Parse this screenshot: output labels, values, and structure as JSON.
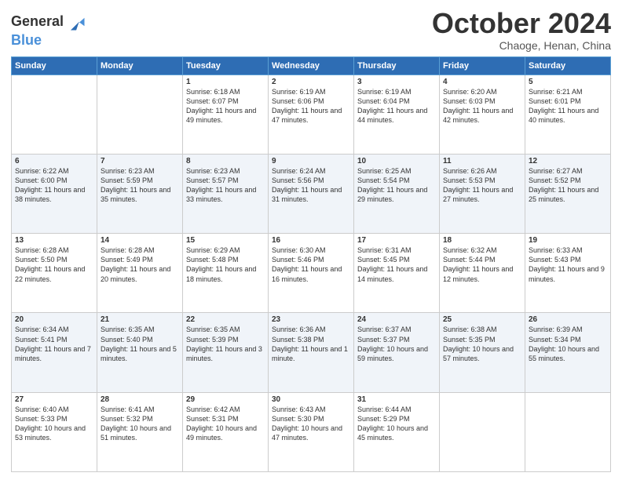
{
  "logo": {
    "line1": "General",
    "line2": "Blue"
  },
  "title": "October 2024",
  "location": "Chaoge, Henan, China",
  "days_of_week": [
    "Sunday",
    "Monday",
    "Tuesday",
    "Wednesday",
    "Thursday",
    "Friday",
    "Saturday"
  ],
  "weeks": [
    [
      {
        "day": "",
        "info": ""
      },
      {
        "day": "",
        "info": ""
      },
      {
        "day": "1",
        "info": "Sunrise: 6:18 AM\nSunset: 6:07 PM\nDaylight: 11 hours and 49 minutes."
      },
      {
        "day": "2",
        "info": "Sunrise: 6:19 AM\nSunset: 6:06 PM\nDaylight: 11 hours and 47 minutes."
      },
      {
        "day": "3",
        "info": "Sunrise: 6:19 AM\nSunset: 6:04 PM\nDaylight: 11 hours and 44 minutes."
      },
      {
        "day": "4",
        "info": "Sunrise: 6:20 AM\nSunset: 6:03 PM\nDaylight: 11 hours and 42 minutes."
      },
      {
        "day": "5",
        "info": "Sunrise: 6:21 AM\nSunset: 6:01 PM\nDaylight: 11 hours and 40 minutes."
      }
    ],
    [
      {
        "day": "6",
        "info": "Sunrise: 6:22 AM\nSunset: 6:00 PM\nDaylight: 11 hours and 38 minutes."
      },
      {
        "day": "7",
        "info": "Sunrise: 6:23 AM\nSunset: 5:59 PM\nDaylight: 11 hours and 35 minutes."
      },
      {
        "day": "8",
        "info": "Sunrise: 6:23 AM\nSunset: 5:57 PM\nDaylight: 11 hours and 33 minutes."
      },
      {
        "day": "9",
        "info": "Sunrise: 6:24 AM\nSunset: 5:56 PM\nDaylight: 11 hours and 31 minutes."
      },
      {
        "day": "10",
        "info": "Sunrise: 6:25 AM\nSunset: 5:54 PM\nDaylight: 11 hours and 29 minutes."
      },
      {
        "day": "11",
        "info": "Sunrise: 6:26 AM\nSunset: 5:53 PM\nDaylight: 11 hours and 27 minutes."
      },
      {
        "day": "12",
        "info": "Sunrise: 6:27 AM\nSunset: 5:52 PM\nDaylight: 11 hours and 25 minutes."
      }
    ],
    [
      {
        "day": "13",
        "info": "Sunrise: 6:28 AM\nSunset: 5:50 PM\nDaylight: 11 hours and 22 minutes."
      },
      {
        "day": "14",
        "info": "Sunrise: 6:28 AM\nSunset: 5:49 PM\nDaylight: 11 hours and 20 minutes."
      },
      {
        "day": "15",
        "info": "Sunrise: 6:29 AM\nSunset: 5:48 PM\nDaylight: 11 hours and 18 minutes."
      },
      {
        "day": "16",
        "info": "Sunrise: 6:30 AM\nSunset: 5:46 PM\nDaylight: 11 hours and 16 minutes."
      },
      {
        "day": "17",
        "info": "Sunrise: 6:31 AM\nSunset: 5:45 PM\nDaylight: 11 hours and 14 minutes."
      },
      {
        "day": "18",
        "info": "Sunrise: 6:32 AM\nSunset: 5:44 PM\nDaylight: 11 hours and 12 minutes."
      },
      {
        "day": "19",
        "info": "Sunrise: 6:33 AM\nSunset: 5:43 PM\nDaylight: 11 hours and 9 minutes."
      }
    ],
    [
      {
        "day": "20",
        "info": "Sunrise: 6:34 AM\nSunset: 5:41 PM\nDaylight: 11 hours and 7 minutes."
      },
      {
        "day": "21",
        "info": "Sunrise: 6:35 AM\nSunset: 5:40 PM\nDaylight: 11 hours and 5 minutes."
      },
      {
        "day": "22",
        "info": "Sunrise: 6:35 AM\nSunset: 5:39 PM\nDaylight: 11 hours and 3 minutes."
      },
      {
        "day": "23",
        "info": "Sunrise: 6:36 AM\nSunset: 5:38 PM\nDaylight: 11 hours and 1 minute."
      },
      {
        "day": "24",
        "info": "Sunrise: 6:37 AM\nSunset: 5:37 PM\nDaylight: 10 hours and 59 minutes."
      },
      {
        "day": "25",
        "info": "Sunrise: 6:38 AM\nSunset: 5:35 PM\nDaylight: 10 hours and 57 minutes."
      },
      {
        "day": "26",
        "info": "Sunrise: 6:39 AM\nSunset: 5:34 PM\nDaylight: 10 hours and 55 minutes."
      }
    ],
    [
      {
        "day": "27",
        "info": "Sunrise: 6:40 AM\nSunset: 5:33 PM\nDaylight: 10 hours and 53 minutes."
      },
      {
        "day": "28",
        "info": "Sunrise: 6:41 AM\nSunset: 5:32 PM\nDaylight: 10 hours and 51 minutes."
      },
      {
        "day": "29",
        "info": "Sunrise: 6:42 AM\nSunset: 5:31 PM\nDaylight: 10 hours and 49 minutes."
      },
      {
        "day": "30",
        "info": "Sunrise: 6:43 AM\nSunset: 5:30 PM\nDaylight: 10 hours and 47 minutes."
      },
      {
        "day": "31",
        "info": "Sunrise: 6:44 AM\nSunset: 5:29 PM\nDaylight: 10 hours and 45 minutes."
      },
      {
        "day": "",
        "info": ""
      },
      {
        "day": "",
        "info": ""
      }
    ]
  ]
}
